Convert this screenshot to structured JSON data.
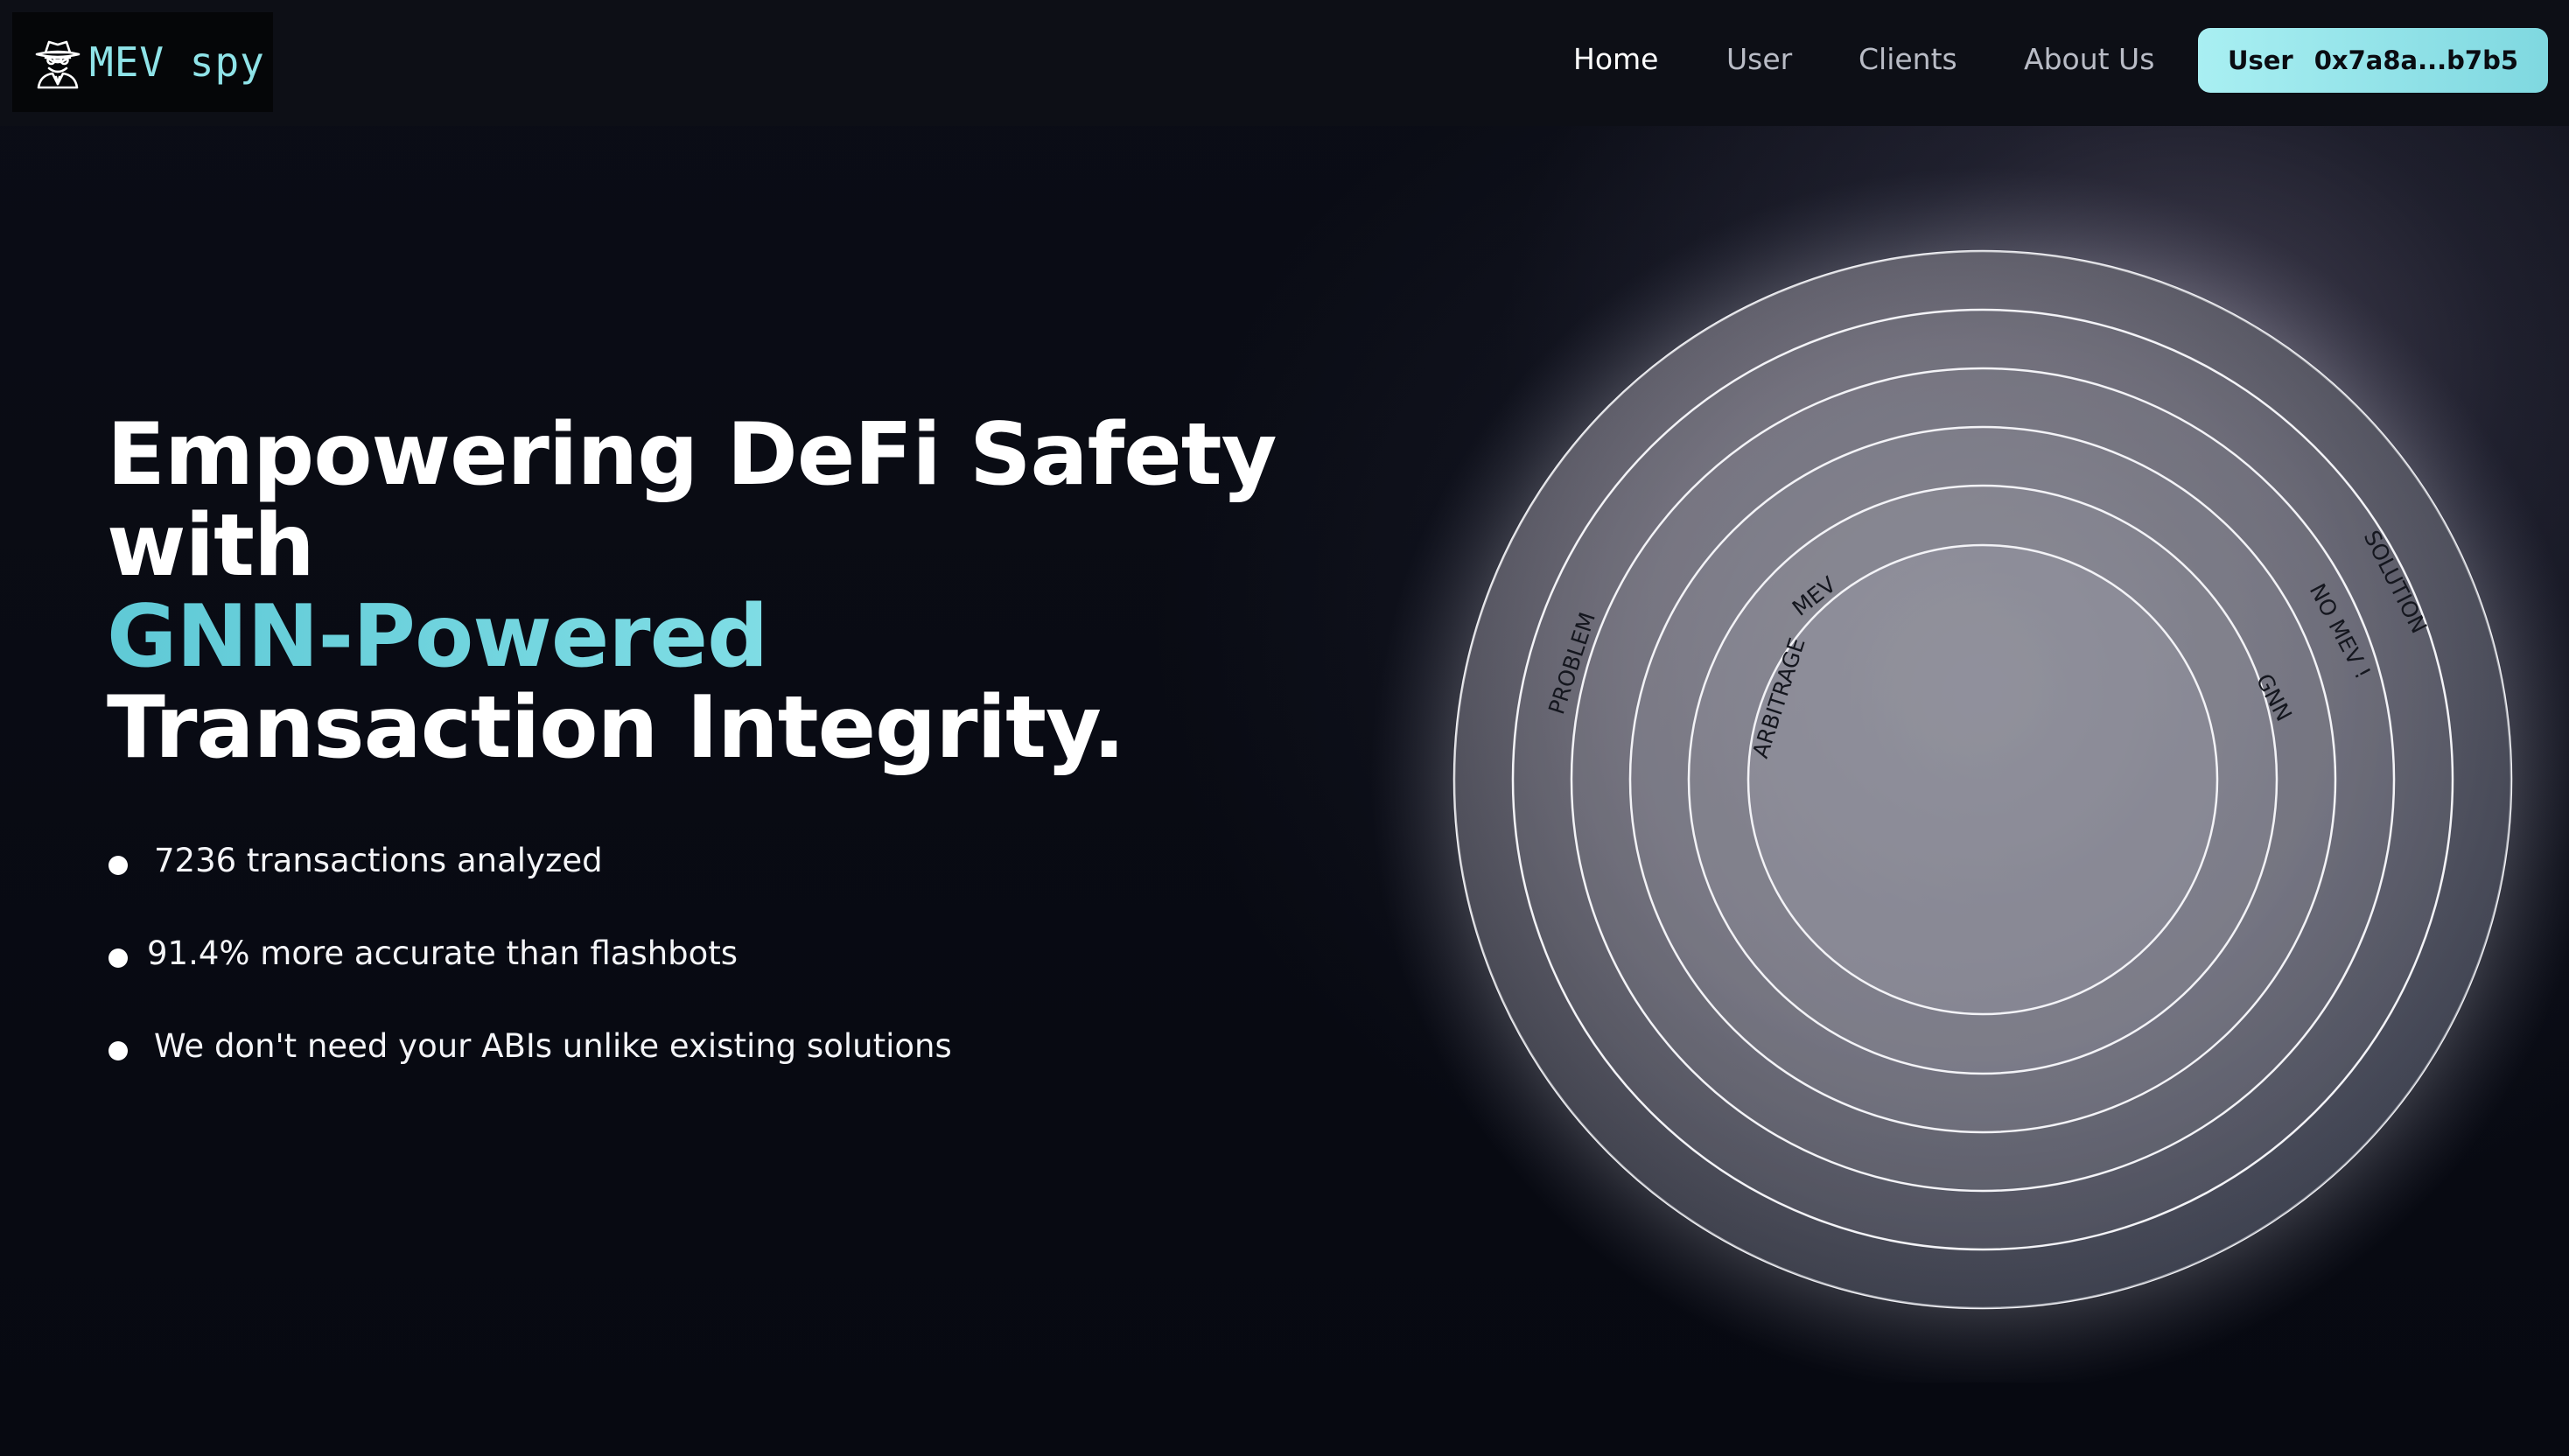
{
  "nav": {
    "logo_text": "MEV spy",
    "logo_icon": "spy-icon",
    "links": [
      "Home",
      "User",
      "Clients",
      "About Us"
    ],
    "active": "Home",
    "wallet": {
      "label": "User",
      "address": "0x7a8a...b7b5"
    }
  },
  "hero": {
    "title_line1": "Empowering DeFi Safety",
    "title_line2": "with",
    "title_accent": "GNN-Powered",
    "title_line4": "Transaction Integrity.",
    "bullets": [
      "7236 transactions analyzed",
      "91.4% more accurate than flashbots",
      "We don't need your ABIs unlike existing solutions"
    ]
  },
  "rings": {
    "labels": [
      "PROBLEM",
      "ARBITRAGE",
      "MEV",
      "GNN",
      "NO MEV !",
      "SOLUTION"
    ]
  },
  "colors": {
    "accent": "#7fd8e0",
    "background": "#070911"
  }
}
